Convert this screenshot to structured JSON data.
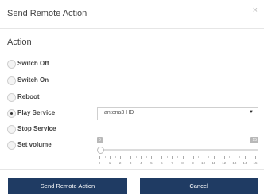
{
  "dialog": {
    "title": "Send Remote Action",
    "close_icon": "×"
  },
  "section": {
    "title": "Action"
  },
  "actions": [
    {
      "label": "Switch Off",
      "checked": false
    },
    {
      "label": "Switch On",
      "checked": false
    },
    {
      "label": "Reboot",
      "checked": false
    },
    {
      "label": "Play Service",
      "checked": true
    },
    {
      "label": "Stop Service",
      "checked": false
    },
    {
      "label": "Set volume",
      "checked": false
    }
  ],
  "service_select": {
    "value": "antena3 HD",
    "caret": "▼"
  },
  "volume": {
    "min": "0",
    "max": "15",
    "value": 0,
    "ticks": [
      "0",
      "1",
      "2",
      "3",
      "4",
      "5",
      "6",
      "7",
      "8",
      "9",
      "10",
      "11",
      "12",
      "13",
      "14",
      "15"
    ]
  },
  "footer": {
    "send_label": "Send Remote Action",
    "cancel_label": "Cancel"
  },
  "colors": {
    "button_bg": "#1f3b63"
  }
}
